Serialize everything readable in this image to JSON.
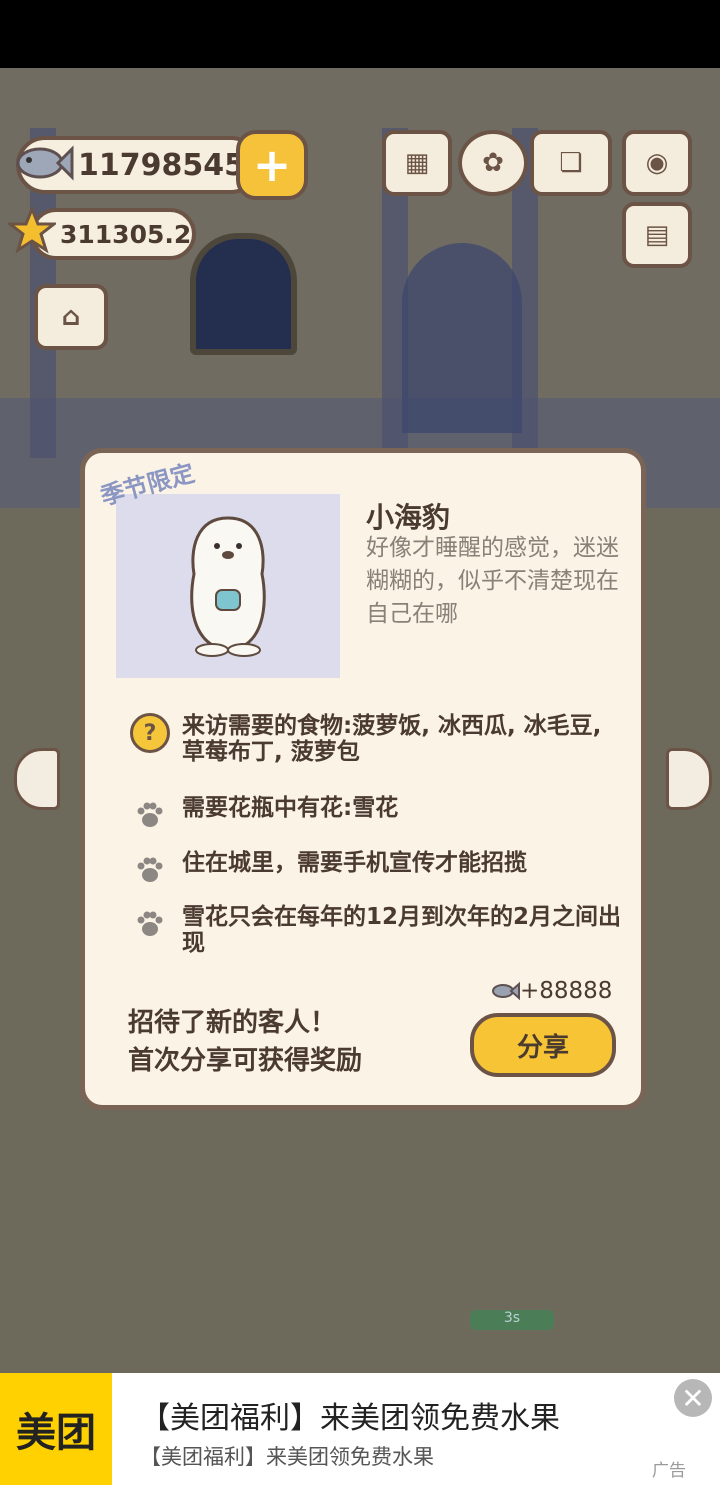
{
  "hud": {
    "coins": "11798545",
    "stars": "311305.2",
    "icons": [
      "fish-icon",
      "plus-icon",
      "ranking-icon",
      "settings-icon",
      "catbook-icon",
      "camera-icon",
      "newspaper-icon",
      "shop-icon"
    ]
  },
  "modal": {
    "badge": "季节限定",
    "name": "小海豹",
    "description": "好像才睡醒的感觉，迷迷糊糊的，似乎不清楚现在自己在哪",
    "requirements": [
      {
        "icon": "question-icon",
        "text": "来访需要的食物:菠萝饭, 冰西瓜, 冰毛豆, 草莓布丁, 菠萝包"
      },
      {
        "icon": "paw-icon",
        "text": "需要花瓶中有花:雪花"
      },
      {
        "icon": "paw-icon",
        "text": "住在城里，需要手机宣传才能招揽"
      },
      {
        "icon": "paw-icon",
        "text": "雪花只会在每年的12月到次年的2月之间出现"
      }
    ],
    "reward": "+88888",
    "invite_line1": "招待了新的客人！",
    "invite_line2": "首次分享可获得奖励",
    "share_label": "分享"
  },
  "scene": {
    "timer": "3s"
  },
  "ad": {
    "logo": "美团",
    "title": "【美团福利】来美团领免费水果",
    "subtitle": "【美团福利】来美团领免费水果",
    "label": "广告"
  },
  "colors": {
    "accent": "#f6c434",
    "panel": "#fbf3e6",
    "border": "#7a6456",
    "ad_brand": "#ffd100"
  }
}
